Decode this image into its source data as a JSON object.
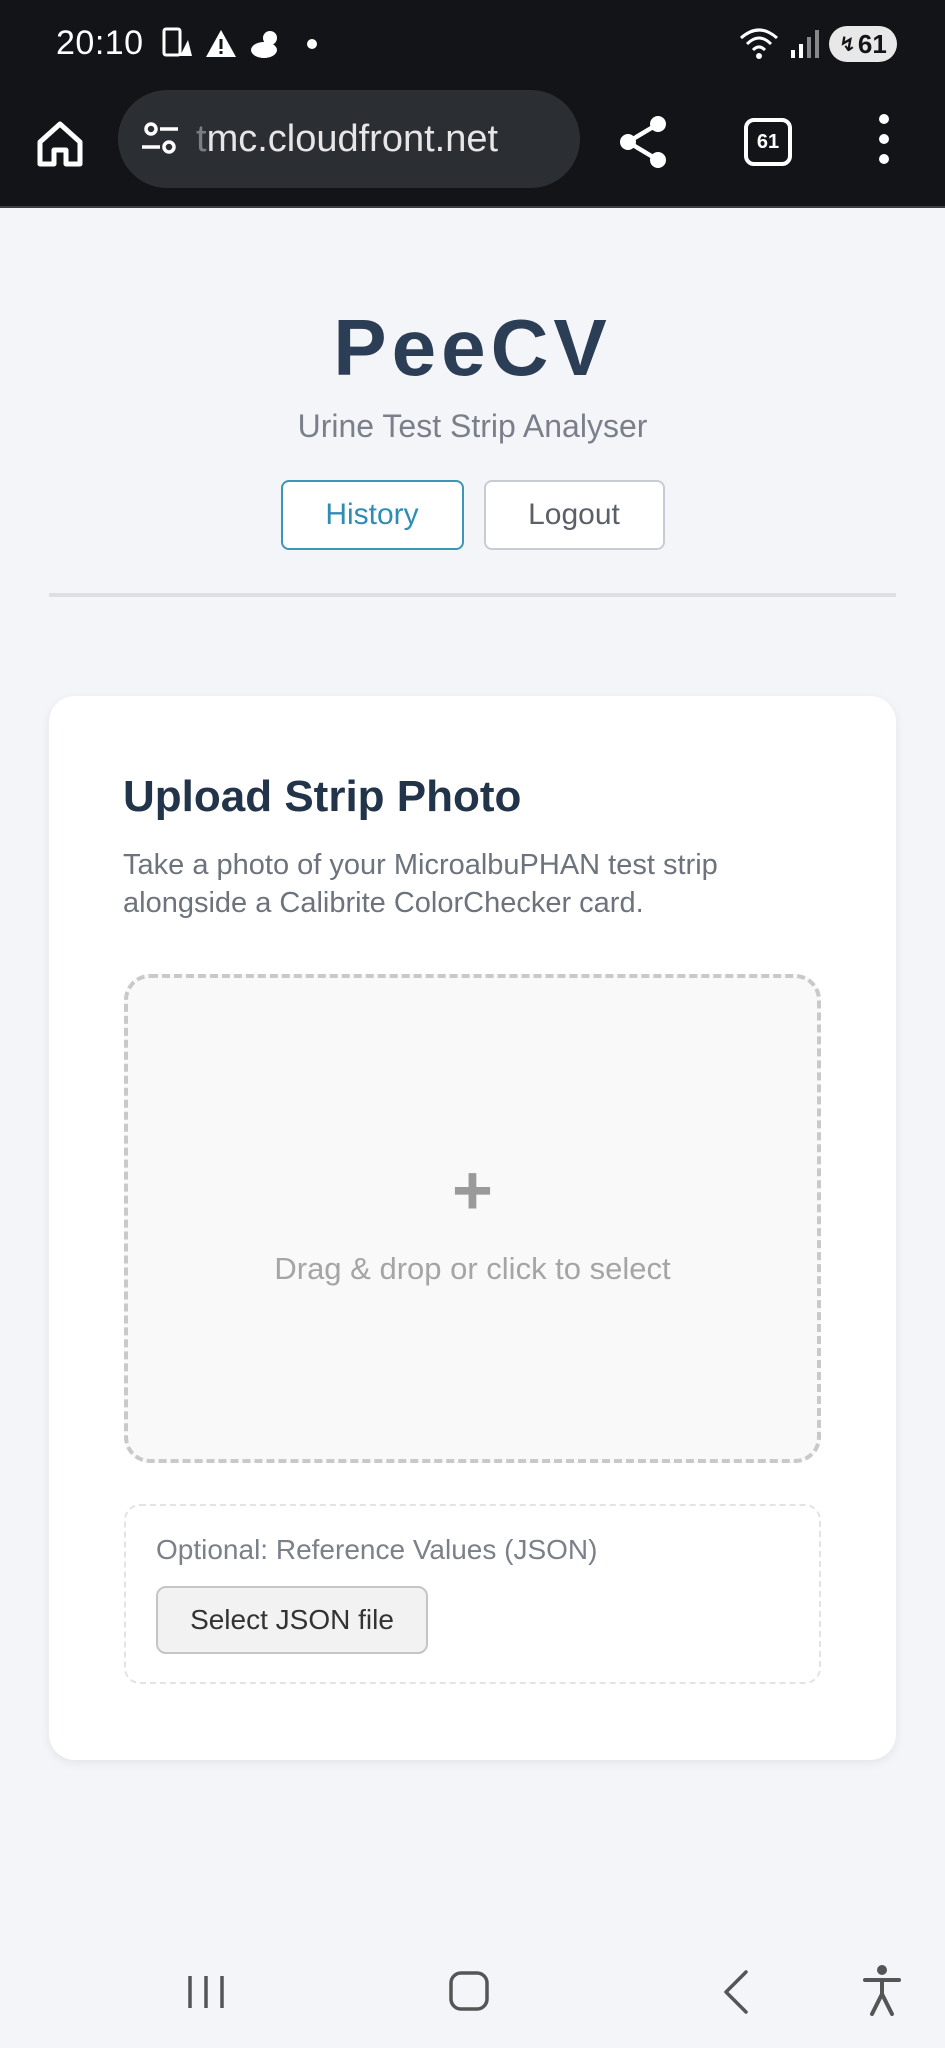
{
  "status_bar": {
    "time": "20:10",
    "battery": "61",
    "notification_icons": [
      "sim-icon",
      "alert-icon",
      "weather-icon",
      "dot-icon"
    ],
    "system_icons": [
      "wifi-icon",
      "signal-icon",
      "battery-icon"
    ]
  },
  "browser": {
    "url_faded": "t",
    "url": "mc.cloudfront.net",
    "tab_count": "61"
  },
  "app": {
    "title": "PeeCV",
    "subtitle": "Urine Test Strip Analyser",
    "history_label": "History",
    "logout_label": "Logout"
  },
  "upload": {
    "title": "Upload Strip Photo",
    "description": "Take a photo of your MicroalbuPHAN test strip alongside a Calibrite ColorChecker card.",
    "dropzone_icon": "+",
    "dropzone_text": "Drag & drop or click to select",
    "json_label": "Optional: Reference Values (JSON)",
    "json_button": "Select JSON file"
  },
  "colors": {
    "accent": "#2f8db4",
    "title": "#2c3e55",
    "page_bg": "#f4f5f9"
  }
}
